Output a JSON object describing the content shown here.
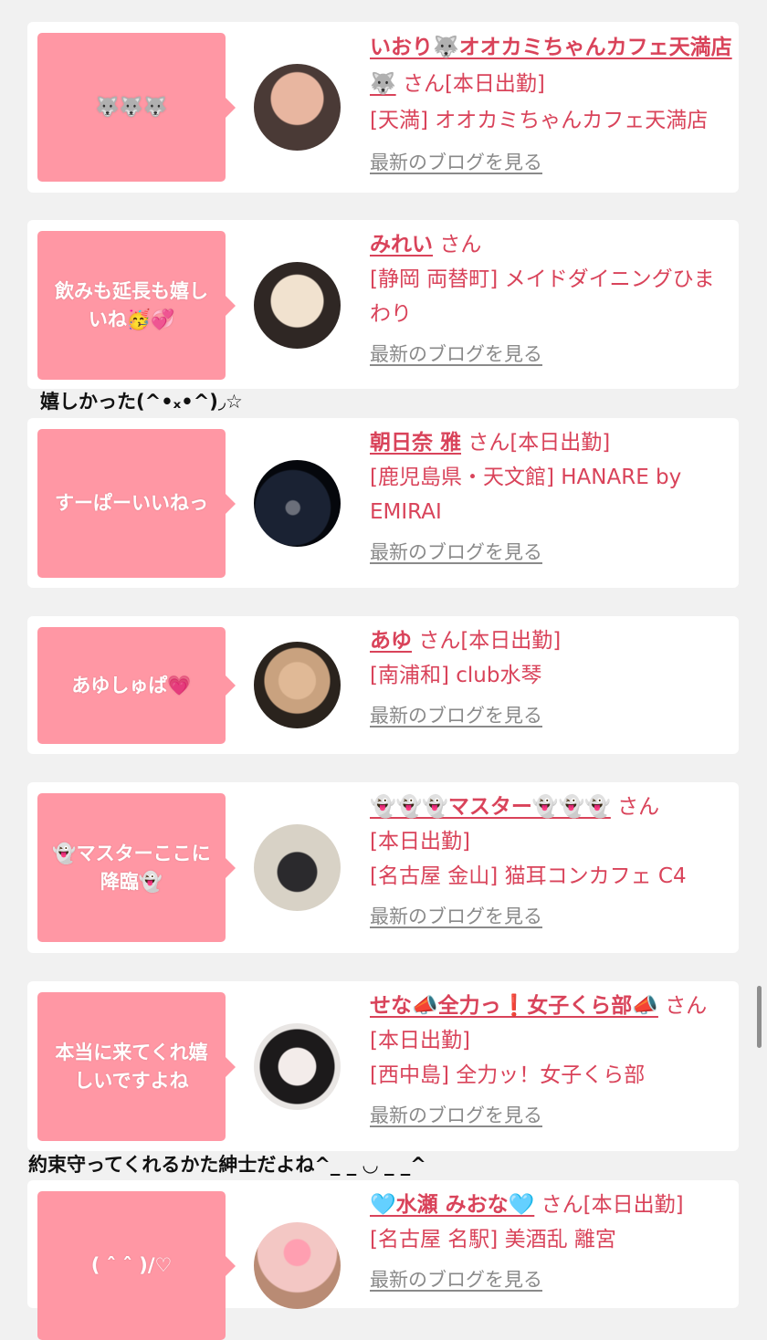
{
  "entries": [
    {
      "message": "🐺🐺🐺",
      "name": "いおり🐺オオカミちゃんカフェ天満店🐺",
      "honorific": "さん",
      "status": "[本日出勤]",
      "shop": "[天満] オオカミちゃんカフェ天満店",
      "blog_link": "最新のブログを見る",
      "avatar_colors": [
        "#e8b6a0",
        "#4a3a36"
      ]
    },
    {
      "message": "飲みも延長も嬉しいね🥳💞",
      "name": "みれい",
      "honorific": "さん",
      "status": "",
      "shop": "[静岡 両替町] メイドダイニングひまわり",
      "blog_link": "最新のブログを見る",
      "avatar_colors": [
        "#f1e2cf",
        "#2f2724"
      ]
    },
    {
      "message": "すーぱーいいねっ",
      "name": "朝日奈 雅",
      "honorific": "さん",
      "status": "[本日出勤]",
      "shop": "[鹿児島県・天文館] HANARE by EMIRAI",
      "blog_link": "最新のブログを見る",
      "avatar_colors": [
        "#1a2233",
        "#05070c"
      ]
    },
    {
      "message": "あゆしゅぱ💗",
      "name": "あゆ",
      "honorific": "さん",
      "status": "[本日出勤]",
      "shop": "[南浦和] club水琴",
      "blog_link": "最新のブログを見る",
      "avatar_colors": [
        "#c9a27f",
        "#2a231d"
      ]
    },
    {
      "message": "👻マスターここに降臨👻",
      "name": "👻👻👻マスター👻👻👻",
      "honorific": "さん",
      "status": "[本日出勤]",
      "shop": "[名古屋 金山] 猫耳コンカフェ C4",
      "blog_link": "最新のブログを見る",
      "avatar_colors": [
        "#d8d2c6",
        "#2b2a2d"
      ]
    },
    {
      "message": "本当に来てくれ嬉しいですよね",
      "name": "せな📣全力っ❗女子くら部📣",
      "honorific": "さん",
      "status": "[本日出勤]",
      "shop": "[西中島] 全力ッ！女子くら部",
      "blog_link": "最新のブログを見る",
      "avatar_colors": [
        "#e9e6e4",
        "#1c1a1b"
      ]
    },
    {
      "message": "( ˆ ˆ )/♡",
      "name": "🩵水瀬 みおな🩵",
      "honorific": "さん",
      "status": "[本日出勤]",
      "shop": "[名古屋 名駅] 美酒乱 離宮",
      "blog_link": "最新のブログを見る",
      "avatar_colors": [
        "#f3c7c4",
        "#b98b74"
      ]
    }
  ],
  "comments": [
    "嬉しかった(^•ₓ•^)◞☆",
    "約束守ってくれるかた紳士だよね^_ _ ◡ _ _^"
  ]
}
